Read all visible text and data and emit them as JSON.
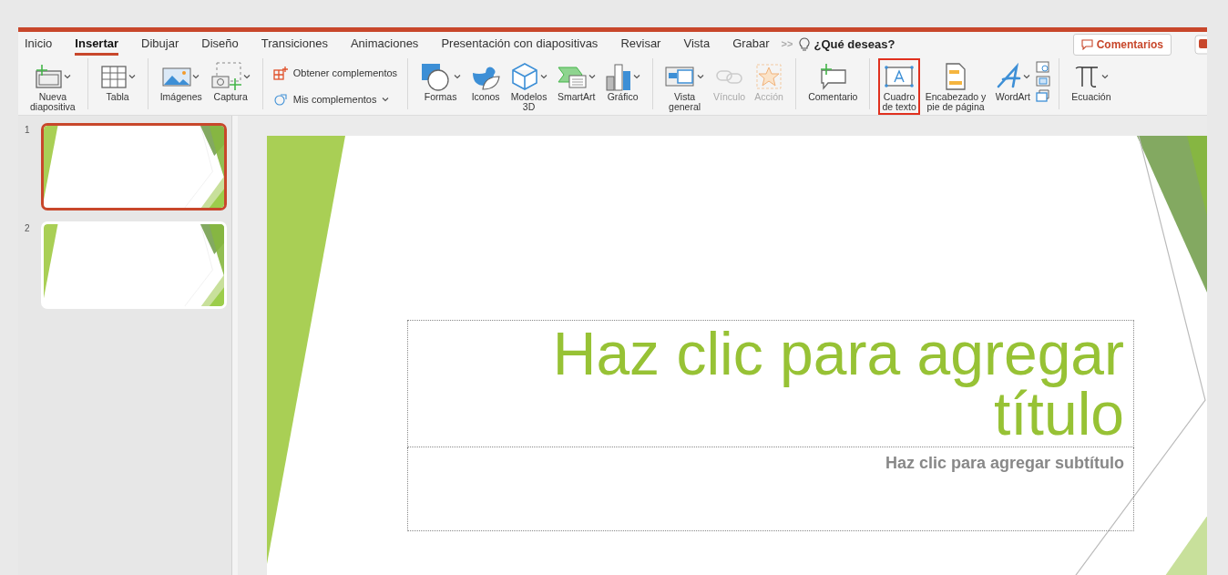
{
  "tabs": [
    {
      "label": "Inicio",
      "selected": false
    },
    {
      "label": "Insertar",
      "selected": true
    },
    {
      "label": "Dibujar",
      "selected": false
    },
    {
      "label": "Diseño",
      "selected": false
    },
    {
      "label": "Transiciones",
      "selected": false
    },
    {
      "label": "Animaciones",
      "selected": false
    },
    {
      "label": "Presentación con diapositivas",
      "selected": false
    },
    {
      "label": "Revisar",
      "selected": false
    },
    {
      "label": "Vista",
      "selected": false
    },
    {
      "label": "Grabar",
      "selected": false
    }
  ],
  "overflow": ">>",
  "search": {
    "label": "¿Qué deseas?"
  },
  "comments_button": {
    "label": "Comentarios"
  },
  "ribbon": {
    "groups": [
      {
        "buttons": [
          {
            "kind": "large",
            "label": "Nueva\ndiapositiva",
            "dropdown": true,
            "disabled": false,
            "highlighted": false
          }
        ]
      },
      {
        "buttons": [
          {
            "kind": "large",
            "label": "Tabla",
            "dropdown": true,
            "disabled": false,
            "highlighted": false
          }
        ]
      },
      {
        "buttons": [
          {
            "kind": "large",
            "label": "Imágenes",
            "dropdown": true,
            "disabled": false,
            "highlighted": false
          },
          {
            "kind": "large",
            "label": "Captura",
            "dropdown": true,
            "disabled": false,
            "highlighted": false
          }
        ]
      },
      {
        "buttons": [
          {
            "kind": "small",
            "label": "Obtener complementos",
            "dropdown": false,
            "disabled": false
          },
          {
            "kind": "small",
            "label": "Mis complementos",
            "dropdown": true,
            "disabled": false
          }
        ]
      },
      {
        "buttons": [
          {
            "kind": "large",
            "label": "Formas",
            "dropdown": true,
            "disabled": false,
            "highlighted": false
          },
          {
            "kind": "large",
            "label": "Iconos",
            "dropdown": false,
            "disabled": false,
            "highlighted": false
          },
          {
            "kind": "large",
            "label": "Modelos\n3D",
            "dropdown": true,
            "disabled": false,
            "highlighted": false
          },
          {
            "kind": "large",
            "label": "SmartArt",
            "dropdown": true,
            "disabled": false,
            "highlighted": false
          },
          {
            "kind": "large",
            "label": "Gráfico",
            "dropdown": true,
            "disabled": false,
            "highlighted": false
          }
        ]
      },
      {
        "buttons": [
          {
            "kind": "large",
            "label": "Vista\ngeneral",
            "dropdown": true,
            "disabled": false,
            "highlighted": false
          },
          {
            "kind": "large",
            "label": "Vínculo",
            "dropdown": false,
            "disabled": true,
            "highlighted": false
          },
          {
            "kind": "large",
            "label": "Acción",
            "dropdown": false,
            "disabled": true,
            "highlighted": false
          }
        ]
      },
      {
        "buttons": [
          {
            "kind": "large",
            "label": "Comentario",
            "dropdown": false,
            "disabled": false,
            "highlighted": false
          }
        ]
      },
      {
        "buttons": [
          {
            "kind": "large",
            "label": "Cuadro\nde texto",
            "dropdown": false,
            "disabled": false,
            "highlighted": true
          },
          {
            "kind": "large",
            "label": "Encabezado y\npie de página",
            "dropdown": false,
            "disabled": false,
            "highlighted": false
          },
          {
            "kind": "large",
            "label": "WordArt",
            "dropdown": true,
            "disabled": false,
            "highlighted": false
          },
          {
            "kind": "stack"
          }
        ]
      },
      {
        "buttons": [
          {
            "kind": "large",
            "label": "Ecuación",
            "dropdown": true,
            "disabled": false,
            "highlighted": false
          }
        ]
      }
    ]
  },
  "slides": [
    {
      "number": "1",
      "selected": true
    },
    {
      "number": "2",
      "selected": false
    }
  ],
  "slide": {
    "title": "Haz clic para agregar título",
    "subtitle": "Haz clic para agregar subtítulo"
  }
}
